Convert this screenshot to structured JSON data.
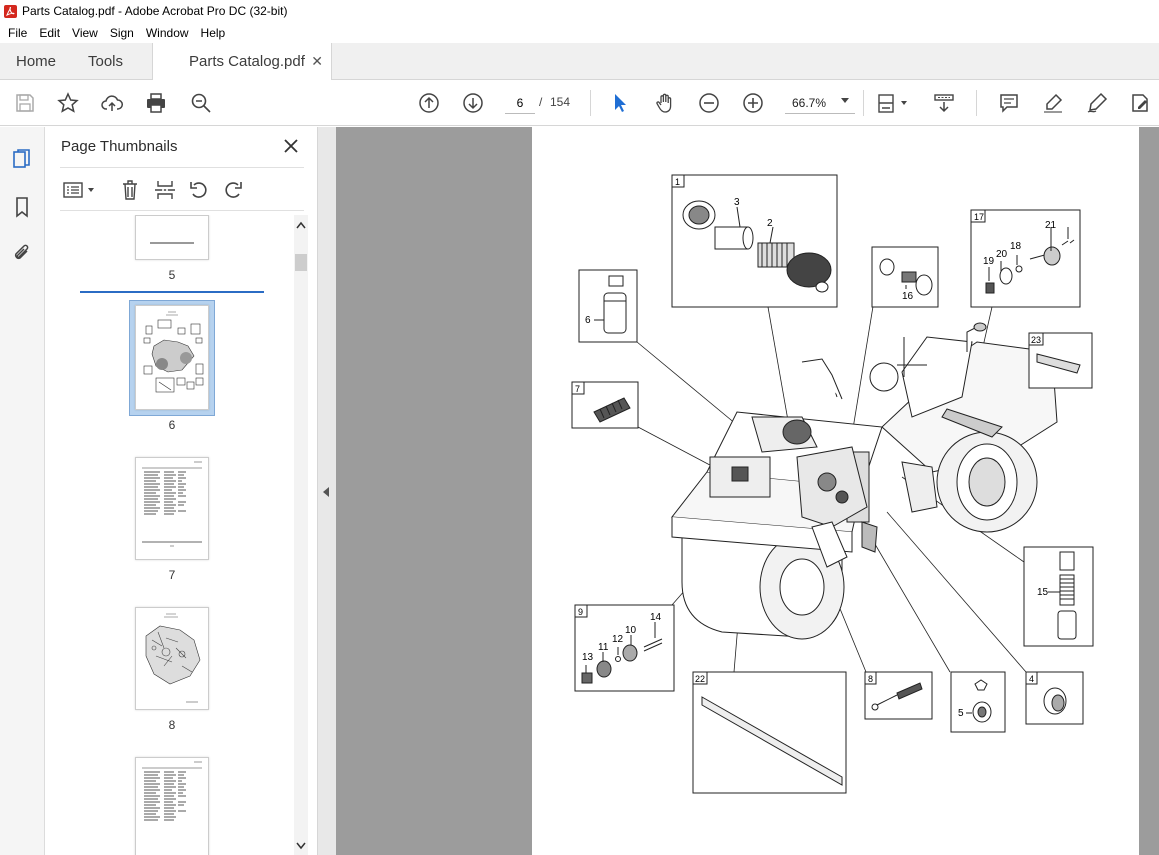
{
  "window": {
    "title": "Parts Catalog.pdf - Adobe Acrobat Pro DC (32-bit)"
  },
  "menu": [
    "File",
    "Edit",
    "View",
    "Sign",
    "Window",
    "Help"
  ],
  "tabs": {
    "home": "Home",
    "tools": "Tools",
    "document": "Parts Catalog.pdf"
  },
  "toolbar": {
    "current_page": "6",
    "page_separator": "/",
    "total_pages": "154",
    "zoom": "66.7%"
  },
  "colors": {
    "accent": "#2b6cc4",
    "viewer_bg": "#9c9c9c",
    "select_blue": "#1f6ed4"
  },
  "sidebar": {
    "title": "Page Thumbnails",
    "thumbnails": [
      {
        "label": "5"
      },
      {
        "label": "6"
      },
      {
        "label": "7"
      },
      {
        "label": "8"
      }
    ]
  },
  "diagram": {
    "callouts": [
      {
        "box": "1",
        "parts": [
          "3",
          "2"
        ]
      },
      {
        "box": "6",
        "parts": [
          "6"
        ]
      },
      {
        "box": "7",
        "parts": []
      },
      {
        "box": "16",
        "parts": [
          "16"
        ]
      },
      {
        "box": "17",
        "parts": [
          "21",
          "20",
          "18",
          "19"
        ]
      },
      {
        "box": "23",
        "parts": []
      },
      {
        "box": "15",
        "parts": [
          "15"
        ]
      },
      {
        "box": "9",
        "parts": [
          "14",
          "10",
          "12",
          "11",
          "13"
        ]
      },
      {
        "box": "22",
        "parts": []
      },
      {
        "box": "8",
        "parts": []
      },
      {
        "box": "5",
        "parts": [
          "5"
        ]
      },
      {
        "box": "4",
        "parts": []
      }
    ]
  }
}
